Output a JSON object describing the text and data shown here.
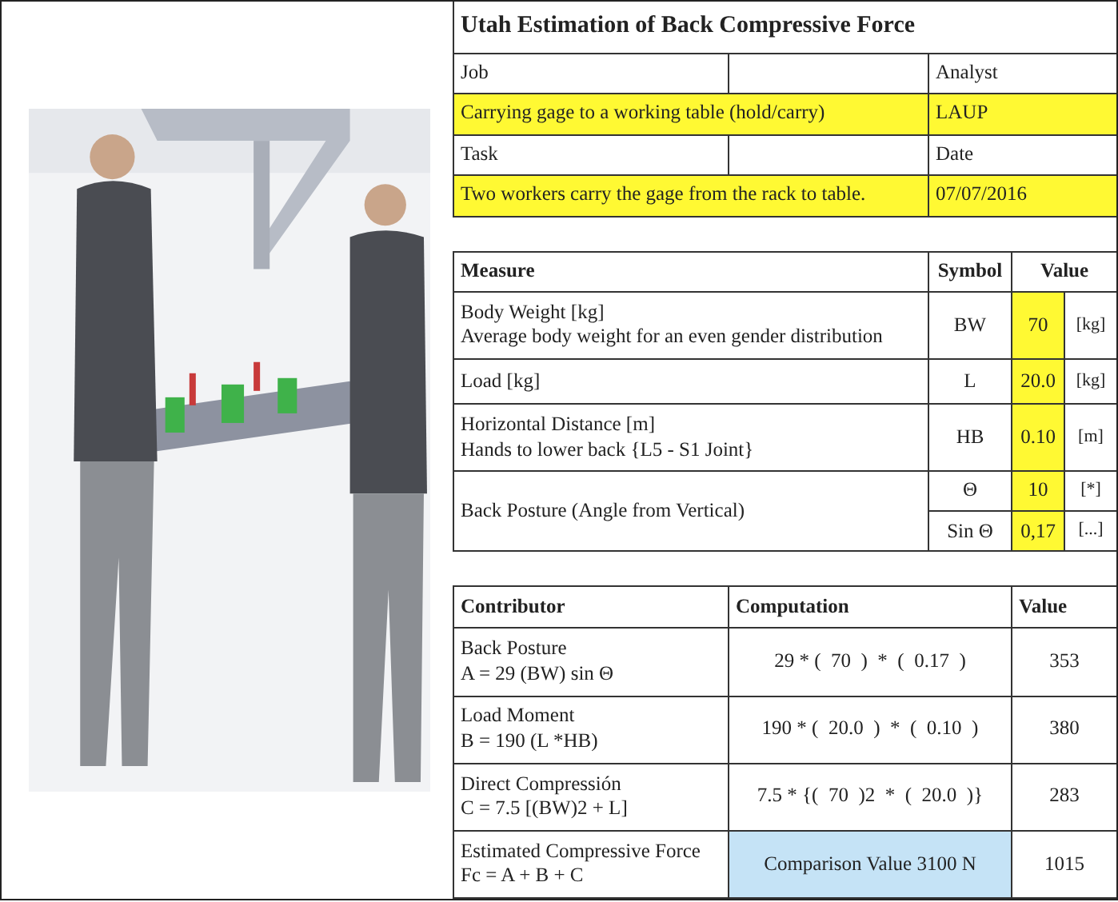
{
  "title": "Utah Estimation of Back Compressive Force",
  "header_rows": [
    {
      "label": "Job",
      "value": "Carrying gage to a working table (hold/carry)",
      "side_label": "Analyst",
      "side_value": "LAUP"
    },
    {
      "label": "Task",
      "value": "Two workers carry the gage from the rack to table.",
      "side_label": "Date",
      "side_value": "07/07/2016"
    }
  ],
  "measures": {
    "columns": [
      "Measure",
      "Symbol",
      "Value"
    ],
    "rows": [
      {
        "name": "Body Weight [kg]",
        "note": "Average body weight for an even gender distribution",
        "entries": [
          {
            "symbol": "BW",
            "value": "70",
            "unit": "[kg]"
          }
        ]
      },
      {
        "name": "Load [kg]",
        "entries": [
          {
            "symbol": "L",
            "value": "20.0",
            "unit": "[kg]"
          }
        ]
      },
      {
        "name": "Horizontal Distance [m]",
        "note": "Hands to lower back {L5 - S1 Joint}",
        "entries": [
          {
            "symbol": "HB",
            "value": "0.10",
            "unit": "[m]"
          }
        ]
      },
      {
        "name": "Back Posture (Angle from Vertical)",
        "entries": [
          {
            "symbol": "Θ",
            "value": "10",
            "unit": "[*]"
          },
          {
            "symbol": "Sin Θ",
            "value": "0,17",
            "unit": "[...]"
          }
        ]
      }
    ]
  },
  "contributors": {
    "columns": [
      "Contributor",
      "Computation",
      "Value"
    ],
    "rows": [
      {
        "name": "Back Posture",
        "formula": "A = 29 (BW) sin Θ",
        "computation": "29 * (  70  )  *  (  0.17  )",
        "value": "353"
      },
      {
        "name": "Load Moment",
        "formula": "B = 190 (L *HB)",
        "computation": "190 * (  20.0  )  *  (  0.10  )",
        "value": "380"
      },
      {
        "name": "Direct Compressión",
        "formula": "C = 7.5 [(BW)2 + L]",
        "computation": "7.5 * {(  70  )2  *  (  20.0  )}",
        "value": "283"
      },
      {
        "name": "Estimated Compressive Force",
        "formula": "Fc = A + B + C",
        "computation": "Comparison Value 3100 N",
        "value": "1015"
      }
    ]
  }
}
